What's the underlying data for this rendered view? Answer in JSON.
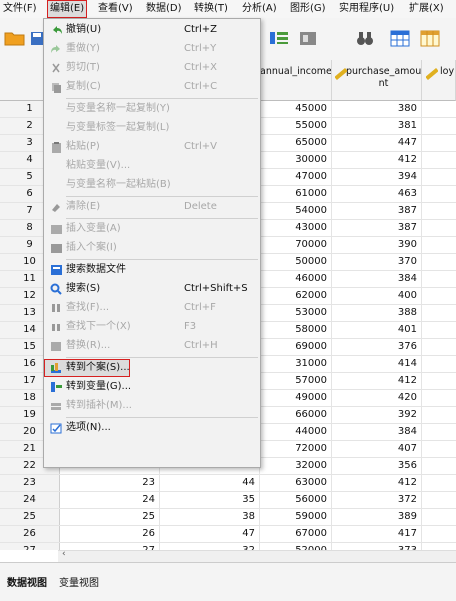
{
  "menubar": [
    {
      "label": "文件(F)",
      "active": false
    },
    {
      "label": "编辑(E)",
      "active": true
    },
    {
      "label": "查看(V)",
      "active": false
    },
    {
      "label": "数据(D)",
      "active": false
    },
    {
      "label": "转换(T)",
      "active": false
    },
    {
      "label": "分析(A)",
      "active": false
    },
    {
      "label": "图形(G)",
      "active": false
    },
    {
      "label": "实用程序(U)",
      "active": false
    },
    {
      "label": "扩展(X)",
      "active": false
    }
  ],
  "columns": {
    "annual_income": "annual_income",
    "purchase_amount": "purchase_amou nt",
    "loyalty": "loy"
  },
  "rows": [
    {
      "n": "1",
      "a": "",
      "b": "",
      "income": "45000",
      "purchase": "380"
    },
    {
      "n": "2",
      "a": "",
      "b": "",
      "income": "55000",
      "purchase": "381"
    },
    {
      "n": "3",
      "a": "",
      "b": "",
      "income": "65000",
      "purchase": "447"
    },
    {
      "n": "4",
      "a": "",
      "b": "",
      "income": "30000",
      "purchase": "412"
    },
    {
      "n": "5",
      "a": "",
      "b": "",
      "income": "47000",
      "purchase": "394"
    },
    {
      "n": "6",
      "a": "",
      "b": "",
      "income": "61000",
      "purchase": "463"
    },
    {
      "n": "7",
      "a": "",
      "b": "",
      "income": "54000",
      "purchase": "387"
    },
    {
      "n": "8",
      "a": "",
      "b": "",
      "income": "43000",
      "purchase": "387"
    },
    {
      "n": "9",
      "a": "",
      "b": "",
      "income": "70000",
      "purchase": "390"
    },
    {
      "n": "10",
      "a": "",
      "b": "",
      "income": "50000",
      "purchase": "370"
    },
    {
      "n": "11",
      "a": "",
      "b": "",
      "income": "46000",
      "purchase": "384"
    },
    {
      "n": "12",
      "a": "",
      "b": "",
      "income": "62000",
      "purchase": "400"
    },
    {
      "n": "13",
      "a": "",
      "b": "",
      "income": "53000",
      "purchase": "388"
    },
    {
      "n": "14",
      "a": "",
      "b": "",
      "income": "58000",
      "purchase": "401"
    },
    {
      "n": "15",
      "a": "",
      "b": "",
      "income": "69000",
      "purchase": "376"
    },
    {
      "n": "16",
      "a": "",
      "b": "",
      "income": "31000",
      "purchase": "414"
    },
    {
      "n": "17",
      "a": "",
      "b": "",
      "income": "57000",
      "purchase": "412"
    },
    {
      "n": "18",
      "a": "",
      "b": "",
      "income": "49000",
      "purchase": "420"
    },
    {
      "n": "19",
      "a": "",
      "b": "",
      "income": "66000",
      "purchase": "392"
    },
    {
      "n": "20",
      "a": "",
      "b": "",
      "income": "44000",
      "purchase": "384"
    },
    {
      "n": "21",
      "a": "",
      "b": "",
      "income": "72000",
      "purchase": "407"
    },
    {
      "n": "22",
      "a": "22",
      "b": "24",
      "income": "32000",
      "purchase": "356"
    },
    {
      "n": "23",
      "a": "23",
      "b": "44",
      "income": "63000",
      "purchase": "412"
    },
    {
      "n": "24",
      "a": "24",
      "b": "35",
      "income": "56000",
      "purchase": "372"
    },
    {
      "n": "25",
      "a": "25",
      "b": "38",
      "income": "59000",
      "purchase": "389"
    },
    {
      "n": "26",
      "a": "26",
      "b": "47",
      "income": "67000",
      "purchase": "417"
    },
    {
      "n": "27",
      "a": "27",
      "b": "32",
      "income": "52000",
      "purchase": "373"
    }
  ],
  "dropdown": [
    {
      "label": "撤销(U)",
      "shortcut": "Ctrl+Z",
      "disabled": false,
      "icon": "undo-icon"
    },
    {
      "label": "重做(Y)",
      "shortcut": "Ctrl+Y",
      "disabled": true,
      "icon": "redo-icon"
    },
    {
      "label": "剪切(T)",
      "shortcut": "Ctrl+X",
      "disabled": true,
      "icon": "cut-icon"
    },
    {
      "label": "复制(C)",
      "shortcut": "Ctrl+C",
      "disabled": true,
      "icon": "copy-icon"
    },
    {
      "label": "与变量名称一起复制(Y)",
      "shortcut": "",
      "disabled": true,
      "icon": ""
    },
    {
      "label": "与变量标签一起复制(L)",
      "shortcut": "",
      "disabled": true,
      "icon": ""
    },
    {
      "label": "粘贴(P)",
      "shortcut": "Ctrl+V",
      "disabled": true,
      "icon": "paste-icon"
    },
    {
      "label": "粘贴变量(V)...",
      "shortcut": "",
      "disabled": true,
      "icon": ""
    },
    {
      "label": "与变量名称一起粘贴(B)",
      "shortcut": "",
      "disabled": true,
      "icon": ""
    },
    {
      "label": "清除(E)",
      "shortcut": "Delete",
      "disabled": true,
      "icon": "eraser-icon"
    },
    {
      "label": "插入变量(A)",
      "shortcut": "",
      "disabled": true,
      "icon": "insert-variable-icon"
    },
    {
      "label": "插入个案(I)",
      "shortcut": "",
      "disabled": true,
      "icon": "insert-case-icon"
    },
    {
      "label": "搜索数据文件",
      "shortcut": "",
      "disabled": false,
      "icon": "search-datafile-icon"
    },
    {
      "label": "搜索(S)",
      "shortcut": "Ctrl+Shift+S",
      "disabled": false,
      "icon": "search-icon"
    },
    {
      "label": "查找(F)...",
      "shortcut": "Ctrl+F",
      "disabled": true,
      "icon": "find-icon"
    },
    {
      "label": "查找下一个(X)",
      "shortcut": "F3",
      "disabled": true,
      "icon": "find-next-icon"
    },
    {
      "label": "替换(R)...",
      "shortcut": "Ctrl+H",
      "disabled": true,
      "icon": "replace-icon"
    },
    {
      "label": "转到个案(S)...",
      "shortcut": "",
      "disabled": false,
      "icon": "goto-case-icon",
      "highlight": true
    },
    {
      "label": "转到变量(G)...",
      "shortcut": "",
      "disabled": false,
      "icon": "goto-variable-icon"
    },
    {
      "label": "转到插补(M)...",
      "shortcut": "",
      "disabled": true,
      "icon": "goto-imputation-icon"
    },
    {
      "label": "选项(N)...",
      "shortcut": "",
      "disabled": false,
      "icon": "options-icon"
    }
  ],
  "tabs": [
    {
      "label": "数据视图",
      "active": true
    },
    {
      "label": "变量视图",
      "active": false
    }
  ],
  "colors": {
    "highlight_border": "#d62020",
    "accent_blue": "#2a6fd6"
  }
}
